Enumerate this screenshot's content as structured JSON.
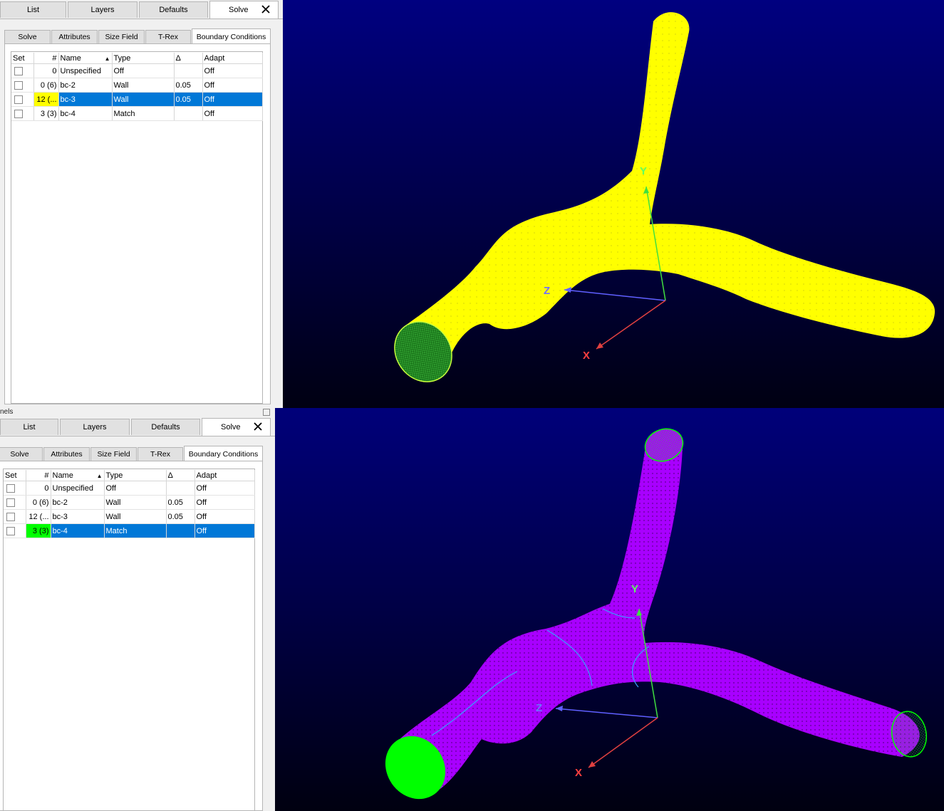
{
  "splitter_label": "nels",
  "top": {
    "tabs": [
      "List",
      "Layers",
      "Defaults",
      "Solve"
    ],
    "subtabs": [
      "Solve",
      "Attributes",
      "Size Field",
      "T-Rex",
      "Boundary Conditions"
    ],
    "columns": [
      "Set",
      "#",
      "Name",
      "Type",
      "Δ",
      "Adapt"
    ],
    "rows": [
      {
        "num": "0",
        "name": "Unspecified",
        "type": "Off",
        "delta": "",
        "adapt": "Off"
      },
      {
        "num": "0 (6)",
        "name": "bc-2",
        "type": "Wall",
        "delta": "0.05",
        "adapt": "Off"
      },
      {
        "num": "12 (...",
        "name": "bc-3",
        "type": "Wall",
        "delta": "0.05",
        "adapt": "Off"
      },
      {
        "num": "3 (3)",
        "name": "bc-4",
        "type": "Match",
        "delta": "",
        "adapt": "Off"
      }
    ],
    "selected_row": 2,
    "highlight_color": "#ffff00"
  },
  "bottom": {
    "tabs": [
      "List",
      "Layers",
      "Defaults",
      "Solve"
    ],
    "subtabs": [
      "Solve",
      "Attributes",
      "Size Field",
      "T-Rex",
      "Boundary Conditions"
    ],
    "columns": [
      "Set",
      "#",
      "Name",
      "Type",
      "Δ",
      "Adapt"
    ],
    "rows": [
      {
        "num": "0",
        "name": "Unspecified",
        "type": "Off",
        "delta": "",
        "adapt": "Off"
      },
      {
        "num": "0 (6)",
        "name": "bc-2",
        "type": "Wall",
        "delta": "0.05",
        "adapt": "Off"
      },
      {
        "num": "12 (...",
        "name": "bc-3",
        "type": "Wall",
        "delta": "0.05",
        "adapt": "Off"
      },
      {
        "num": "3 (3)",
        "name": "bc-4",
        "type": "Match",
        "delta": "",
        "adapt": "Off"
      }
    ],
    "selected_row": 3,
    "highlight_color": "#00ff00"
  },
  "viewport_top": {
    "mesh_color": "#ffff00",
    "cap_color": "#2f9e2f",
    "axes": {
      "x": "X",
      "y": "Y",
      "z": "Z"
    }
  },
  "viewport_bottom": {
    "mesh_color": "#a800ff",
    "cap_color": "#00ff00",
    "axes": {
      "x": "X",
      "y": "Y",
      "z": "Z"
    }
  },
  "colors": {
    "bg_top": "#000080",
    "bg_bottom": "#000010",
    "selection": "#0078d7",
    "axis_x": "#e04040",
    "axis_y": "#40e040",
    "axis_z": "#6060ff"
  }
}
